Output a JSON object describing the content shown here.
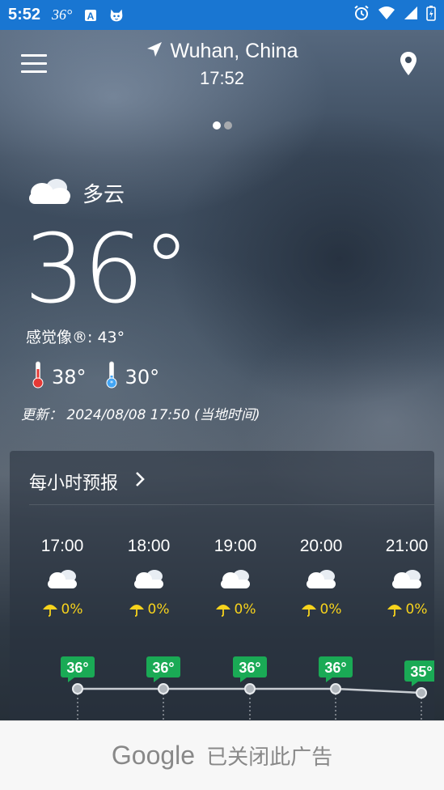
{
  "status_bar": {
    "time": "5:52",
    "temp": "36°",
    "icons": [
      "app-a-icon",
      "cat-icon",
      "alarm-icon",
      "wifi-icon",
      "signal-icon",
      "battery-charging-icon"
    ]
  },
  "header": {
    "location": "Wuhan, China",
    "time": "17:52",
    "pages": 2,
    "active_page": 0
  },
  "current": {
    "condition": "多云",
    "temp": "36°",
    "feels_like": "感觉像®: 43°",
    "high": "38°",
    "low": "30°",
    "updated": "更新： 2024/08/08 17:50 (当地时间)"
  },
  "hourly": {
    "title": "每小时预报",
    "hours": [
      {
        "time": "17:00",
        "rain": "0%",
        "temp": "36°"
      },
      {
        "time": "18:00",
        "rain": "0%",
        "temp": "36°"
      },
      {
        "time": "19:00",
        "rain": "0%",
        "temp": "36°"
      },
      {
        "time": "20:00",
        "rain": "0%",
        "temp": "36°"
      },
      {
        "time": "21:00",
        "rain": "0%",
        "temp": "35°"
      }
    ]
  },
  "ad": {
    "brand": "Google",
    "text": "已关闭此广告"
  },
  "colors": {
    "status_bar": "#1976d2",
    "temp_badge": "#1aaa55",
    "rain": "#f7d31c"
  }
}
